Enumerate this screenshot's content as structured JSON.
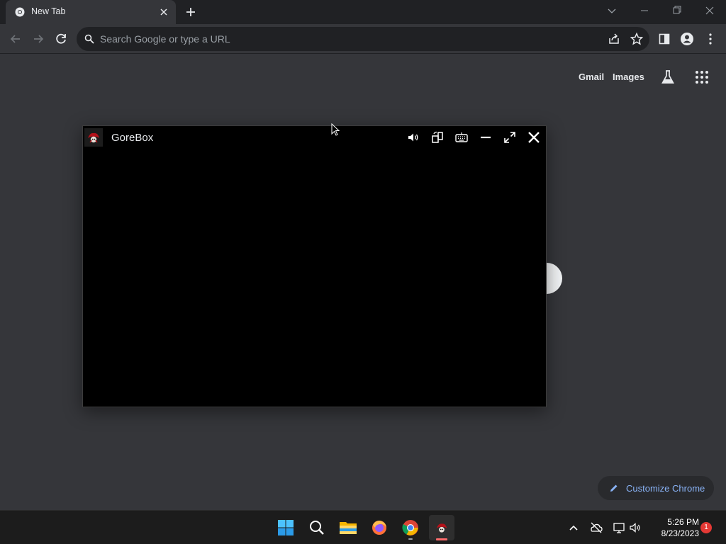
{
  "tab": {
    "title": "New Tab"
  },
  "omnibox": {
    "placeholder": "Search Google or type a URL"
  },
  "header_links": {
    "gmail": "Gmail",
    "images": "Images"
  },
  "app_window": {
    "title": "GoreBox"
  },
  "customize": {
    "label": "Customize Chrome"
  },
  "taskbar": {
    "time": "5:26 PM",
    "date": "8/23/2023",
    "notification_count": "1"
  },
  "colors": {
    "accent": "#8ab4f8",
    "badge": "#e53935",
    "page_bg": "#35363a"
  }
}
